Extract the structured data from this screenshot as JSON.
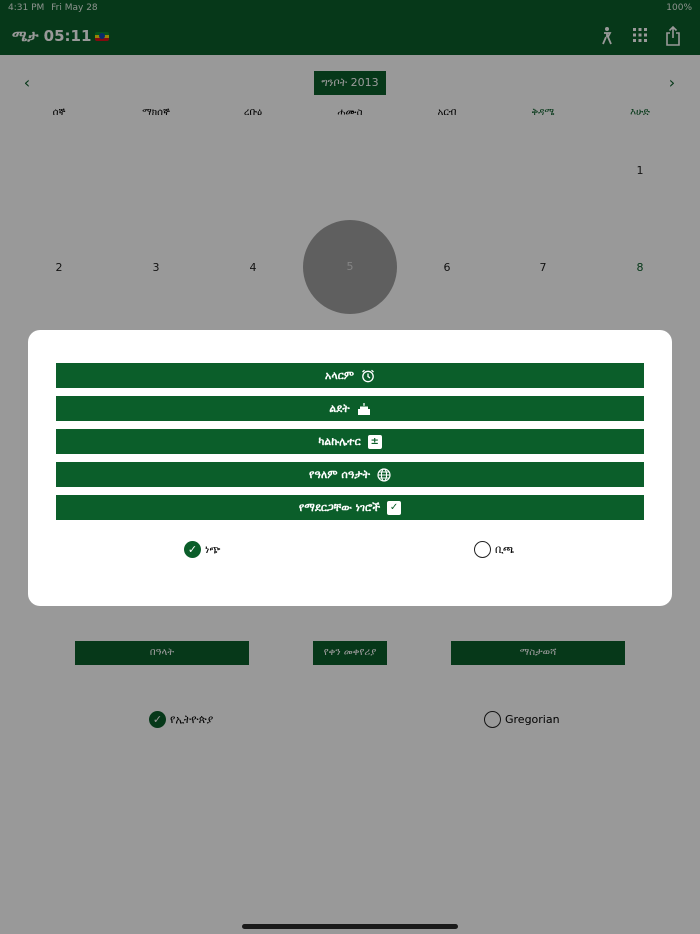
{
  "status_bar": {
    "time": "4:31 PM",
    "date": "Fri May 28",
    "battery": "100%"
  },
  "nav": {
    "title": "ሜታ 05:11",
    "icons": [
      "person-icon",
      "grid-icon",
      "share-icon"
    ]
  },
  "calendar": {
    "month_label": "ግንቦት 2013",
    "weekdays": [
      "ሰኞ",
      "ማክሰኞ",
      "ረቡዕ",
      "ሐሙስ",
      "አርብ",
      "ቅዳሜ",
      "እሁድ"
    ],
    "week1": [
      "1"
    ],
    "week2": [
      "2",
      "3",
      "4",
      "5",
      "6",
      "7",
      "8"
    ],
    "today": "5"
  },
  "bottom": {
    "buttons": [
      "በዓላት",
      "የቀን መቀየሪያ",
      "ማስታወሻ"
    ],
    "radio_selected": "የኢትዮጵያ",
    "radio_unselected": "Gregorian"
  },
  "modal": {
    "items": [
      {
        "label": "አላርም",
        "icon": "alarm-clock-icon"
      },
      {
        "label": "ልደት",
        "icon": "birthday-cake-icon"
      },
      {
        "label": "ካልኩሌተር",
        "icon": "calculator-icon"
      },
      {
        "label": "የዓለም ሰዓታት",
        "icon": "globe-icon"
      },
      {
        "label": "የማደርጋቸው ነገሮች",
        "icon": "checkbox-icon"
      }
    ],
    "option_selected": "ነጭ",
    "option_unselected": "ቢጫ"
  },
  "colors": {
    "primary": "#0b5e2a",
    "overlay": "rgba(0,0,0,0.4)"
  }
}
